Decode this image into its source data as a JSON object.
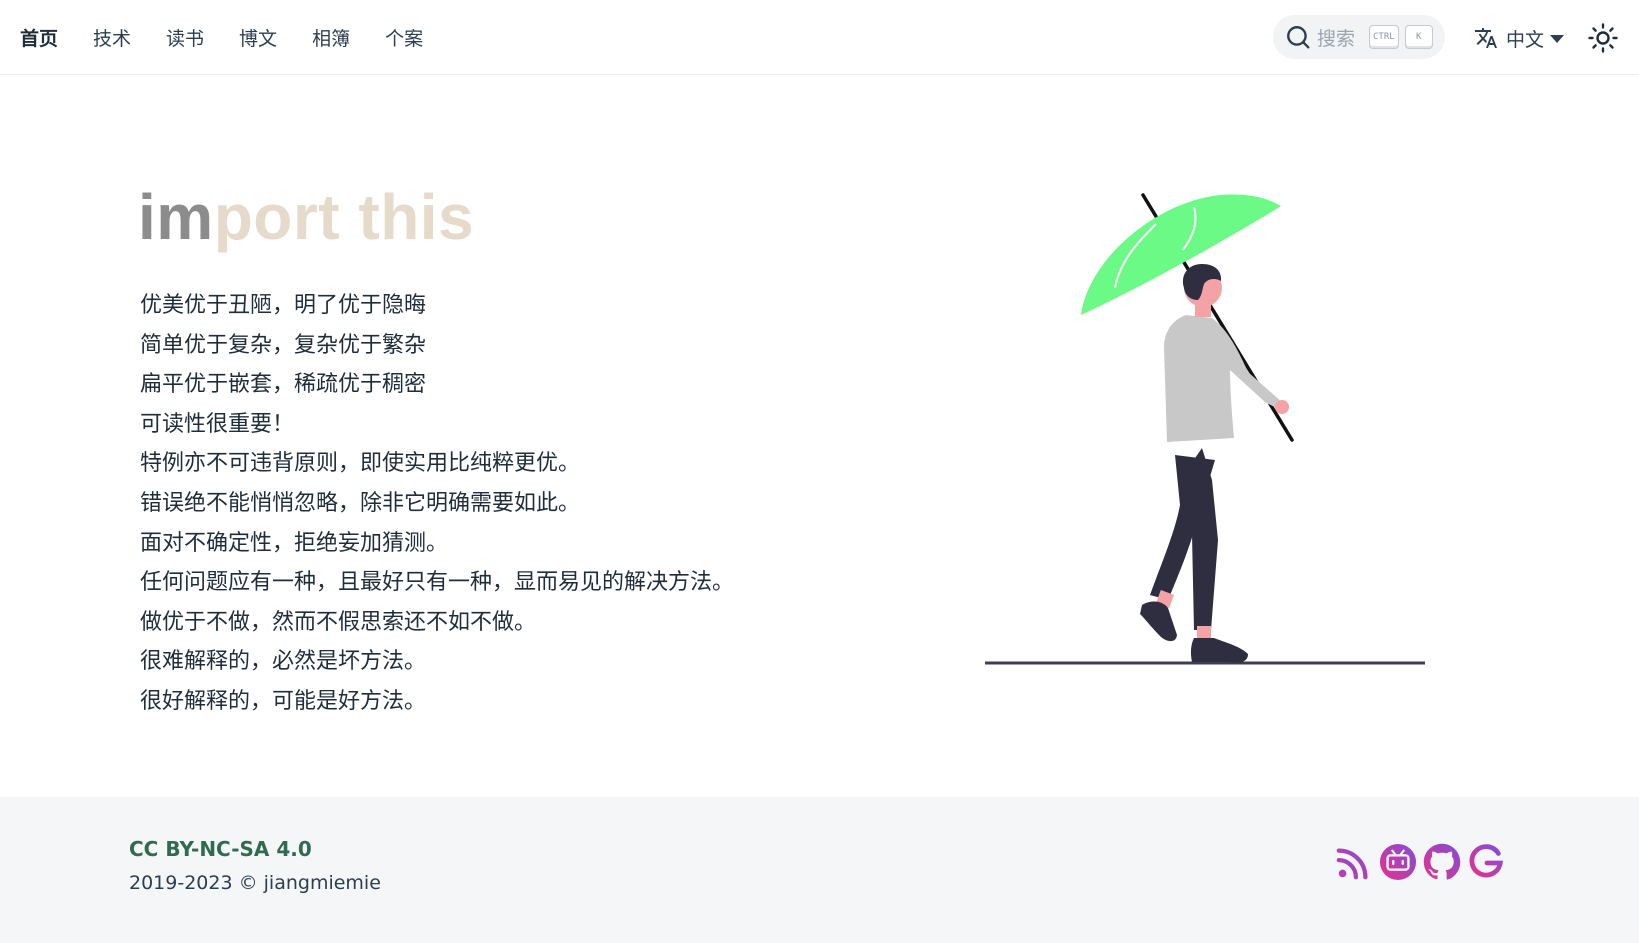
{
  "nav": {
    "items": [
      {
        "label": "首页",
        "active": true
      },
      {
        "label": "技术"
      },
      {
        "label": "读书"
      },
      {
        "label": "博文"
      },
      {
        "label": "相簿"
      },
      {
        "label": "个案"
      }
    ],
    "search": {
      "placeholder": "搜索",
      "keys": [
        "CTRL",
        "K"
      ]
    },
    "language": {
      "label": "中文",
      "icon": "translate-icon"
    },
    "theme_icon": "sun-icon"
  },
  "hero": {
    "title_typed": "im",
    "title_rest": "port this",
    "lines": [
      "优美优于丑陋，明了优于隐晦",
      "简单优于复杂，复杂优于繁杂",
      "扁平优于嵌套，稀疏优于稠密",
      "可读性很重要！",
      "特例亦不可违背原则，即使实用比纯粹更优。",
      "错误绝不能悄悄忽略，除非它明确需要如此。",
      "面对不确定性，拒绝妄加猜测。",
      "任何问题应有一种，且最好只有一种，显而易见的解决方法。",
      "做优于不做，然而不假思索还不如不做。",
      "很难解释的，必然是坏方法。",
      "很好解释的，可能是好方法。"
    ],
    "illustration": "person-walking-with-umbrella",
    "colors": {
      "umbrella": "#6bfa86",
      "shirt": "#c8c8c8",
      "pants": "#2f2e41",
      "skin": "#f3a3a6"
    }
  },
  "footer": {
    "license": "CC BY-NC-SA 4.0",
    "copyright": "2019-2023 © jiangmiemie",
    "social_icons": [
      "rss-icon",
      "bilibili-icon",
      "github-icon",
      "google-icon"
    ]
  }
}
